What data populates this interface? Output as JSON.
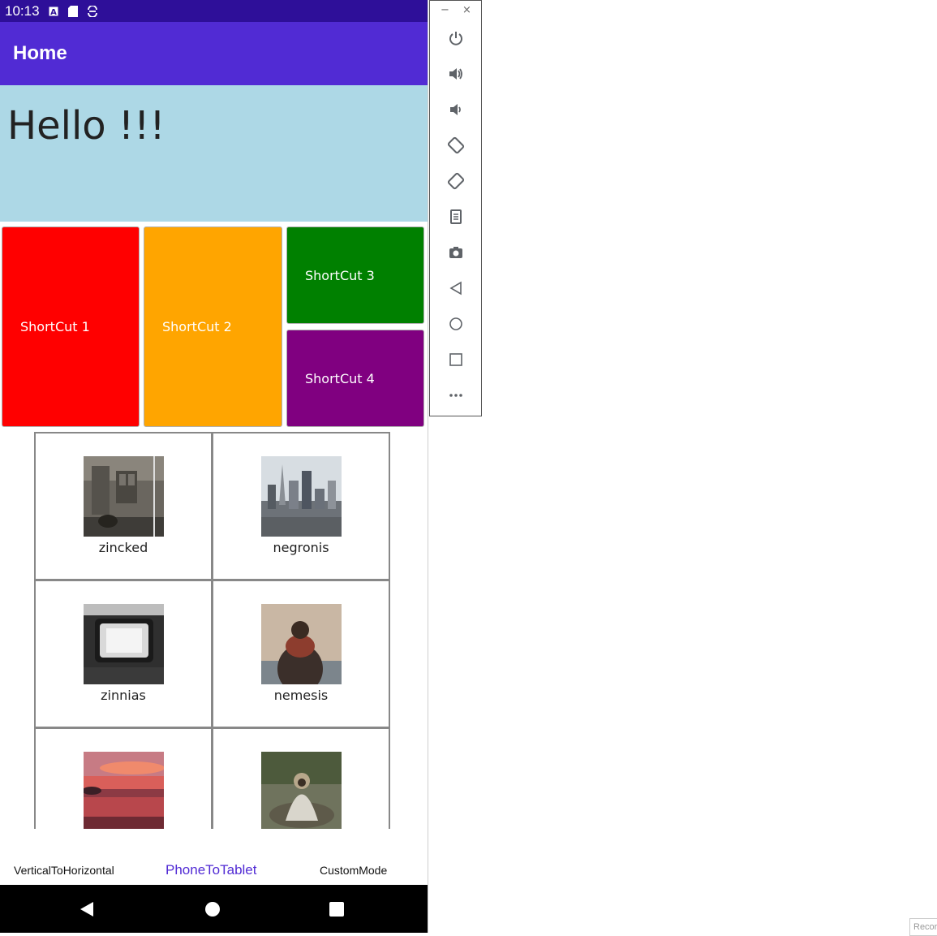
{
  "status_bar": {
    "time": "10:13",
    "icons": [
      "a-icon",
      "sd-card-icon",
      "sync-icon"
    ],
    "color": "#2e0f99"
  },
  "app_bar": {
    "title": "Home",
    "color": "#512bd4"
  },
  "hello": {
    "text": "Hello !!!",
    "background": "#add8e6"
  },
  "shortcuts": [
    {
      "label": "ShortCut 1",
      "color": "#ff0000"
    },
    {
      "label": "ShortCut 2",
      "color": "#ffa500"
    },
    {
      "label": "ShortCut 3",
      "color": "#008000"
    },
    {
      "label": "ShortCut 4",
      "color": "#800080"
    }
  ],
  "gallery": [
    {
      "label": "zincked"
    },
    {
      "label": "negronis"
    },
    {
      "label": "zinnias"
    },
    {
      "label": "nemesis"
    },
    {
      "label": ""
    },
    {
      "label": ""
    }
  ],
  "tabs": [
    {
      "label": "VerticalToHorizontal"
    },
    {
      "label": "PhoneToTablet",
      "selected": true,
      "color": "#512bd4"
    },
    {
      "label": "CustomMode"
    }
  ],
  "nav": {
    "icons": [
      "back-icon",
      "home-icon",
      "recents-icon"
    ]
  },
  "emulator_panel": {
    "window_controls": [
      "−",
      "×"
    ],
    "icons": [
      "power-icon",
      "volume-up-icon",
      "volume-down-icon",
      "rotate-left-icon",
      "rotate-right-icon",
      "clipboard-icon",
      "camera-icon",
      "back-icon",
      "home-icon",
      "overview-icon",
      "more-icon"
    ]
  },
  "record_label": "Recor"
}
